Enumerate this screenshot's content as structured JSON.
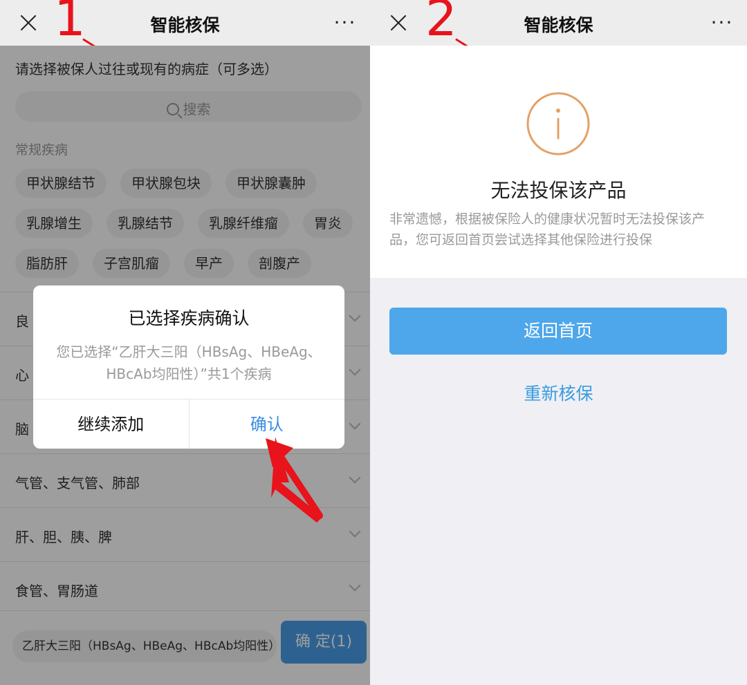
{
  "left": {
    "step_label": "1",
    "nav": {
      "title": "智能核保",
      "more": "···"
    },
    "prompt": "请选择被保人过往或现有的病症（可多选）",
    "search_placeholder": "搜索",
    "section_title": "常规疾病",
    "tag_rows": [
      [
        "甲状腺结节",
        "甲状腺包块",
        "甲状腺囊肿"
      ],
      [
        "乳腺增生",
        "乳腺结节",
        "乳腺纤维瘤",
        "胃炎"
      ],
      [
        "脂肪肝",
        "子宫肌瘤",
        "早产",
        "剖腹产"
      ]
    ],
    "categories": [
      "良",
      "心",
      "脑",
      "气管、支气管、肺部",
      "肝、胆、胰、脾",
      "食管、胃肠道"
    ],
    "selected_chip": "乙肝大三阳（HBsAg、HBeAg、HBcAb均阳性）",
    "confirm_button": "确 定(1)",
    "dialog": {
      "title": "已选择疾病确认",
      "message": "您已选择“乙肝大三阳（HBsAg、HBeAg、HBcAb均阳性）”共1个疾病",
      "continue_label": "继续添加",
      "confirm_label": "确认"
    },
    "annotation_color": "#e8131b"
  },
  "right": {
    "step_label": "2",
    "nav": {
      "title": "智能核保",
      "more": "···"
    },
    "icon": "info-circle-icon",
    "result_title": "无法投保该产品",
    "result_message": "非常遗憾，根据被保险人的健康状况暂时无法投保该产品，您可返回首页尝试选择其他保险进行投保",
    "home_button": "返回首页",
    "reassess_link": "重新核保",
    "accent_color": "#4ea7ea"
  }
}
